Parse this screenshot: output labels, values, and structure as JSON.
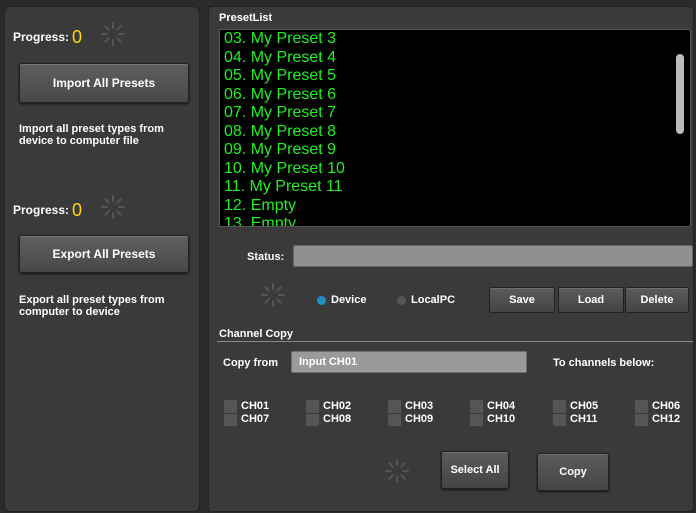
{
  "left": {
    "import": {
      "progress_label": "Progress:",
      "progress_value": "0",
      "button_label": "Import All Presets",
      "description": "Import all preset types from device to computer file"
    },
    "export": {
      "progress_label": "Progress:",
      "progress_value": "0",
      "button_label": "Export All Presets",
      "description": "Export all preset types from computer to device"
    }
  },
  "preset_list": {
    "title": "PresetList",
    "items": [
      "03. My Preset 3",
      "04. My Preset 4",
      "05. My Preset 5",
      "06. My Preset 6",
      "07. My Preset 7",
      "08. My Preset 8",
      "09. My Preset 9",
      "10. My Preset 10",
      "11. My Preset 11",
      "12. Empty",
      "13. Empty"
    ],
    "status_label": "Status:",
    "status_value": "",
    "target_options": [
      {
        "label": "Device",
        "selected": true
      },
      {
        "label": "LocalPC",
        "selected": false
      }
    ],
    "buttons": {
      "save": "Save",
      "load": "Load",
      "delete": "Delete"
    }
  },
  "channel_copy": {
    "title": "Channel Copy",
    "copy_from_label": "Copy from",
    "copy_from_value": "Input CH01",
    "to_channels_label": "To channels below:",
    "channels": [
      "CH01",
      "CH02",
      "CH03",
      "CH04",
      "CH05",
      "CH06",
      "CH07",
      "CH08",
      "CH09",
      "CH10",
      "CH11",
      "CH12"
    ],
    "select_all_label": "Select All",
    "copy_label": "Copy"
  },
  "colors": {
    "preset_text": "#22ee22",
    "progress_value": "#ffd800",
    "radio_selected": "#1e8fc0",
    "radio_unselected": "#555555"
  }
}
